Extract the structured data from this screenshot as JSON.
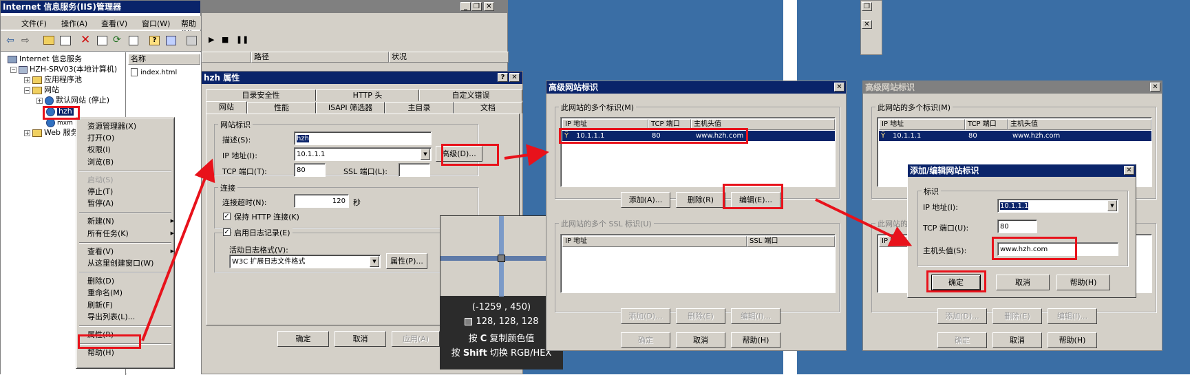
{
  "bg": {
    "blue": "#3a6ea5"
  },
  "iis": {
    "title": "Internet 信息服务(IIS)管理器",
    "menus": [
      "文件(F)",
      "操作(A)",
      "查看(V)",
      "窗口(W)",
      "帮助(H)"
    ],
    "tree": {
      "root": "Internet 信息服务",
      "server": "HZH-SRV03(本地计算机)",
      "apppool": "应用程序池",
      "sites": "网站",
      "default_site": "默认网站 (停止)",
      "hzh": "hzh",
      "mxm": "mxm",
      "web_ext": "Web 服务"
    },
    "list_header": "名称",
    "list_item": "index.html",
    "col_path": "路径",
    "col_status": "状况"
  },
  "context_menu": [
    {
      "label": "资源管理器(X)"
    },
    {
      "label": "打开(O)"
    },
    {
      "label": "权限(I)"
    },
    {
      "label": "浏览(B)"
    },
    {
      "sep": true
    },
    {
      "label": "启动(S)",
      "disabled": true
    },
    {
      "label": "停止(T)"
    },
    {
      "label": "暂停(A)"
    },
    {
      "sep": true
    },
    {
      "label": "新建(N)",
      "sub": true
    },
    {
      "label": "所有任务(K)",
      "sub": true
    },
    {
      "sep": true
    },
    {
      "label": "查看(V)",
      "sub": true
    },
    {
      "label": "从这里创建窗口(W)"
    },
    {
      "sep": true
    },
    {
      "label": "删除(D)"
    },
    {
      "label": "重命名(M)"
    },
    {
      "label": "刷新(F)"
    },
    {
      "label": "导出列表(L)..."
    },
    {
      "sep": true
    },
    {
      "label": "属性(R)"
    },
    {
      "sep": true
    },
    {
      "label": "帮助(H)"
    }
  ],
  "props": {
    "title": "hzh 属性",
    "tabs_back": [
      "目录安全性",
      "HTTP 头",
      "自定义错误"
    ],
    "tabs_front": [
      "网站",
      "性能",
      "ISAPI 筛选器",
      "主目录",
      "文档"
    ],
    "site_group": "网站标识",
    "desc_label": "描述(S):",
    "desc_value": "hzh",
    "ip_label": "IP 地址(I):",
    "ip_value": "10.1.1.1",
    "adv_button": "高级(D)...",
    "tcp_label": "TCP 端口(T):",
    "tcp_value": "80",
    "ssl_label": "SSL 端口(L):",
    "ssl_value": "",
    "conn_group": "连接",
    "timeout_label": "连接超时(N):",
    "timeout_value": "120",
    "timeout_unit": "秒",
    "keepalive_label": "保持 HTTP 连接(K)",
    "log_label": "启用日志记录(E)",
    "log_format_label": "活动日志格式(V):",
    "log_format_value": "W3C 扩展日志文件格式",
    "log_props_button": "属性(P)...",
    "ok": "确定",
    "cancel": "取消",
    "apply": "应用(A)",
    "help": "帮助"
  },
  "color_picker": {
    "coords": "(-1259 , 450)",
    "rgb": "128, 128, 128",
    "hint1_pre": "按",
    "hint1_key": "C",
    "hint1_post": "复制颜色值",
    "hint2_pre": "按",
    "hint2_key": "Shift",
    "hint2_post": "切换 RGB/HEX"
  },
  "adv1": {
    "title": "高级网站标识",
    "multi_label": "此网站的多个标识(M)",
    "cols": [
      "IP 地址",
      "TCP 端口",
      "主机头值"
    ],
    "row": [
      "10.1.1.1",
      "80",
      "www.hzh.com"
    ],
    "add": "添加(A)...",
    "remove": "删除(R)",
    "edit": "编辑(E)...",
    "ssl_label": "此网站的多个 SSL 标识(U)",
    "ssl_cols": [
      "IP 地址",
      "SSL 端口"
    ],
    "add2": "添加(D)...",
    "remove2": "删除(E)",
    "edit2": "编辑(I)...",
    "ok": "确定",
    "cancel": "取消",
    "help": "帮助(H)"
  },
  "adv2": {
    "title": "高级网站标识",
    "multi_label": "此网站的多个标识(M)",
    "cols": [
      "IP 地址",
      "TCP 端口",
      "主机头值"
    ],
    "row": [
      "10.1.1.1",
      "80",
      "www.hzh.com"
    ],
    "ssl_label_partial": "此网站的",
    "ssl_col_partial": "IP 地址",
    "add2": "添加(D)...",
    "remove2": "删除(E)",
    "edit2": "编辑(I)...",
    "ok": "确定",
    "cancel": "取消",
    "help": "帮助(H)"
  },
  "edit_dialog": {
    "title": "添加/编辑网站标识",
    "group": "标识",
    "ip_label": "IP 地址(I):",
    "ip_value": "10.1.1.1",
    "tcp_label": "TCP 端口(U):",
    "tcp_value": "80",
    "host_label": "主机头值(S):",
    "host_value": "www.hzh.com",
    "ok": "确定",
    "cancel": "取消",
    "help": "帮助(H)"
  }
}
